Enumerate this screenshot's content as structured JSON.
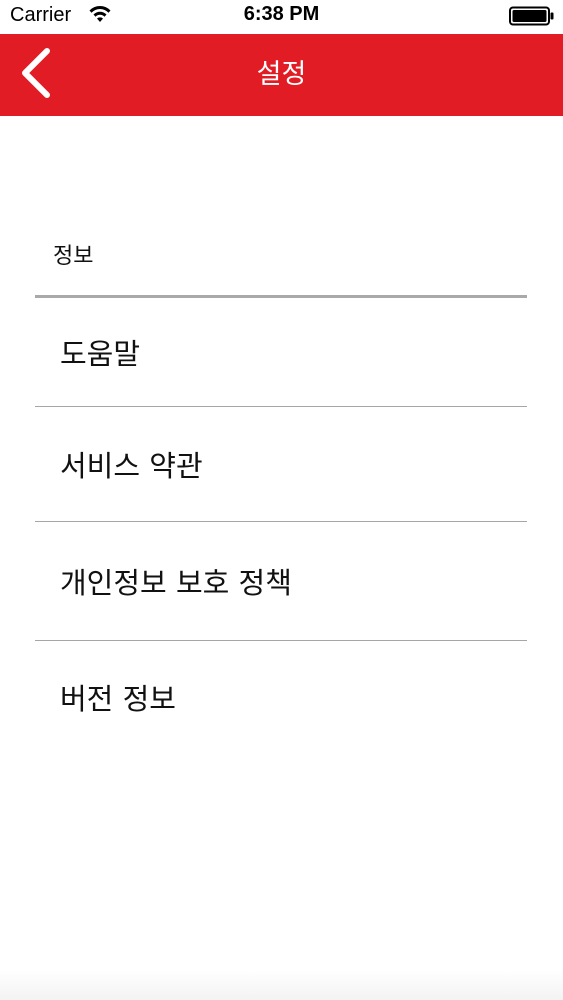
{
  "status_bar": {
    "carrier": "Carrier",
    "time": "6:38 PM",
    "wifi_icon": "wifi-icon",
    "battery_icon": "battery-full-icon"
  },
  "nav": {
    "title": "설정",
    "back_icon": "chevron-left-icon",
    "background_color": "#e21c24"
  },
  "section": {
    "header": "정보",
    "items": [
      {
        "label": "도움말"
      },
      {
        "label": "서비스 약관"
      },
      {
        "label": "개인정보 보호 정책"
      },
      {
        "label": "버전 정보"
      }
    ]
  }
}
